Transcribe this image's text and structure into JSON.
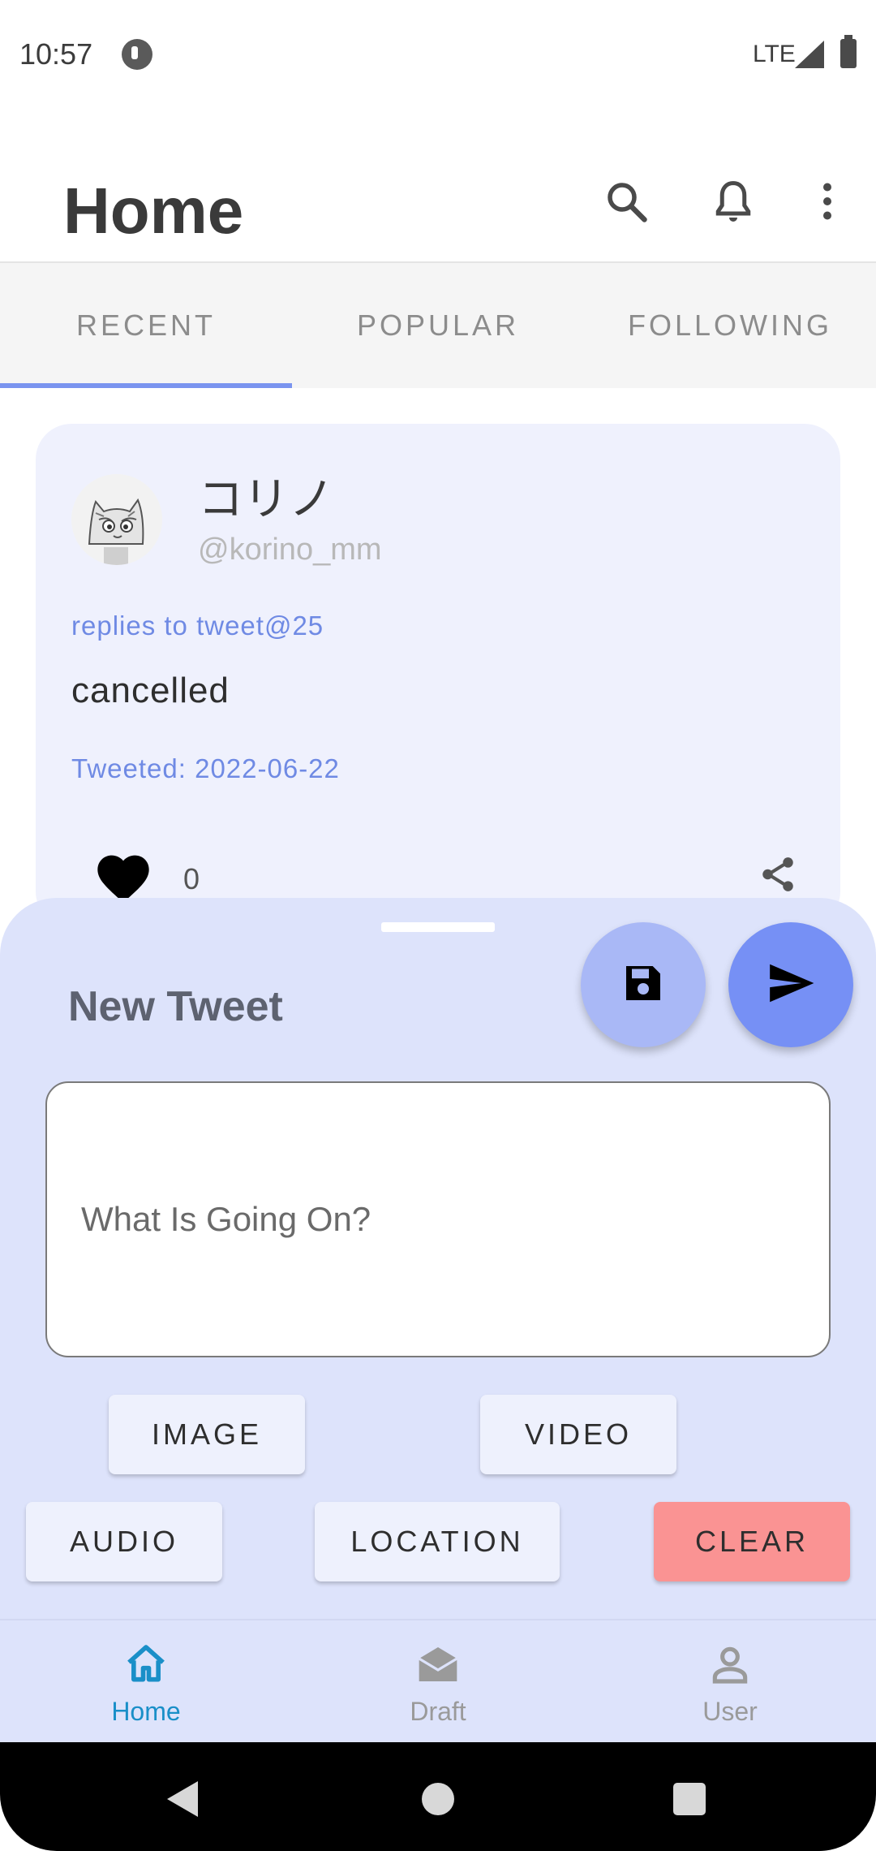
{
  "status_bar": {
    "time": "10:57",
    "network": "LTE"
  },
  "header": {
    "title": "Home",
    "icons": [
      "search-icon",
      "bell-icon",
      "more-vert-icon"
    ]
  },
  "tabs": [
    {
      "label": "RECENT",
      "selected": true
    },
    {
      "label": "POPULAR",
      "selected": false
    },
    {
      "label": "FOLLOWING",
      "selected": false
    }
  ],
  "tweet": {
    "author_name": "コリノ",
    "author_handle": "@korino_mm",
    "reply_to": "replies to tweet@25",
    "text": "cancelled",
    "date": "Tweeted: 2022-06-22",
    "like_count": "0"
  },
  "compose": {
    "title": "New Tweet",
    "placeholder": "What Is Going On?",
    "value": "",
    "buttons": {
      "image": "IMAGE",
      "video": "VIDEO",
      "audio": "AUDIO",
      "location": "LOCATION",
      "clear": "CLEAR"
    }
  },
  "bottom_nav": [
    {
      "label": "Home",
      "icon": "home-icon",
      "active": true
    },
    {
      "label": "Draft",
      "icon": "draft-icon",
      "active": false
    },
    {
      "label": "User",
      "icon": "user-icon",
      "active": false
    }
  ],
  "colors": {
    "accent": "#7a94ef",
    "link": "#6f8ae4",
    "card_bg": "#eff1fd",
    "sheet_bg": "#dde3fb",
    "clear_button": "#fa9393",
    "nav_active": "#1a8fc8"
  }
}
